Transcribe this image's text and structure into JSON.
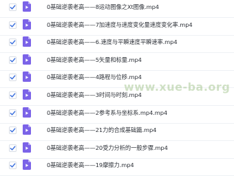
{
  "colors": {
    "checkbox_check": "#3b6fdd",
    "file_icon": "#7b63e8",
    "file_icon_fold": "#b8a9f5",
    "row_divider": "#eef1f5",
    "text": "#2b2f36",
    "watermark": "#78aa5a"
  },
  "icons": {
    "checkbox": "check-icon",
    "file": "video-file-icon"
  },
  "files": [
    {
      "name": "0基础逆袭老高——8运动图像之Xt图像.mp4",
      "checked": true
    },
    {
      "name": "0基础逆袭老高——7加速度与速度变化量速度变化率.mp4",
      "checked": true
    },
    {
      "name": "0基础逆袭老高——6.速度与平瞬速度平瞬速率.mp4",
      "checked": true
    },
    {
      "name": "0基础逆袭老高——5矢量和标量.mp4",
      "checked": true
    },
    {
      "name": "0基础逆袭老高——4路程与位移.mp4",
      "checked": true
    },
    {
      "name": "0基础逆袭老高——3时间与时刻.mp4",
      "checked": true
    },
    {
      "name": "0基础逆袭老高——2参考系与坐标系.mp4.mp4",
      "checked": true
    },
    {
      "name": "0基础逆袭老高——21力的合成基础篇.mp4",
      "checked": true
    },
    {
      "name": "0基础逆袭老高——20受力分析的一般步骤.mp4",
      "checked": true
    },
    {
      "name": "0基础逆袭老高——19摩擦力.mp4",
      "checked": true
    }
  ],
  "watermark": "www.xue-ba.org"
}
